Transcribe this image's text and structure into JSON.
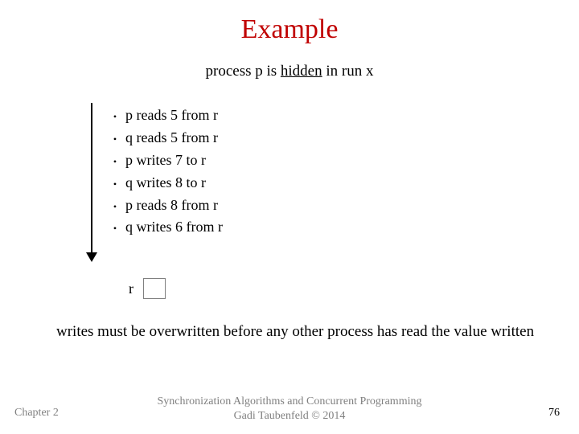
{
  "title": "Example",
  "subtitle": {
    "prefix": "process p is ",
    "underlined": "hidden",
    "suffix": " in run x"
  },
  "bullets": [
    "p reads 5 from r",
    "q reads 5 from r",
    "p writes 7 to r",
    "q writes 8 to r",
    "p reads 8 from r",
    "q writes 6 from r"
  ],
  "register_label": "r",
  "note": "writes must be overwritten before any other process has read the value written",
  "footer": {
    "left": "Chapter 2",
    "center_line1": "Synchronization Algorithms and Concurrent Programming",
    "center_line2": "Gadi Taubenfeld © 2014",
    "right": "76"
  }
}
